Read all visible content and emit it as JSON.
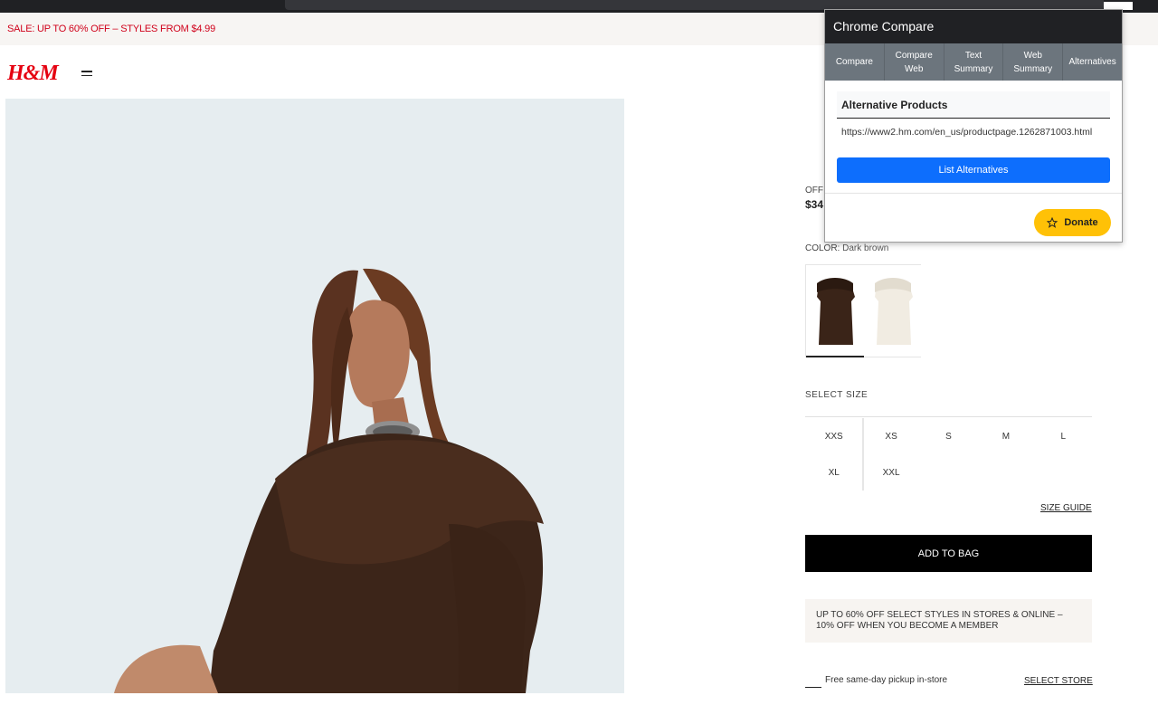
{
  "promo": {
    "text": "SALE: UP TO 60% OFF – STYLES FROM $4.99"
  },
  "header": {
    "logo": "H&M"
  },
  "product": {
    "offer_label": "OFF",
    "price": "$34",
    "color_label": "COLOR:",
    "color_value": "Dark brown",
    "swatches": [
      {
        "name": "Dark brown",
        "color": "#3a2418",
        "selected": true
      },
      {
        "name": "Cream",
        "color": "#f1ece2",
        "selected": false
      }
    ],
    "select_size_label": "SELECT SIZE",
    "sizes_row1": [
      "XXS",
      "XS",
      "S",
      "M",
      "L"
    ],
    "sizes_row2": [
      "XL",
      "XXL"
    ],
    "size_guide": "SIZE GUIDE",
    "add_to_bag": "ADD TO BAG",
    "member_banner": "UP TO 60% OFF SELECT STYLES IN STORES & ONLINE – 10% OFF WHEN YOU BECOME A MEMBER",
    "pickup_text": "Free same-day pickup in-store",
    "select_store": "SELECT STORE"
  },
  "extension": {
    "title": "Chrome Compare",
    "tabs": [
      "Compare",
      "Compare Web",
      "Text Summary",
      "Web Summary",
      "Alternatives"
    ],
    "section_title": "Alternative Products",
    "url": "https://www2.hm.com/en_us/productpage.1262871003.html",
    "list_button": "List Alternatives",
    "donate_label": "Donate",
    "donate_icon": "star-icon"
  },
  "colors": {
    "brand_red": "#e50010",
    "promo_red": "#d0021b",
    "button_blue": "#0d6efd",
    "donate_yellow": "#ffc107"
  }
}
